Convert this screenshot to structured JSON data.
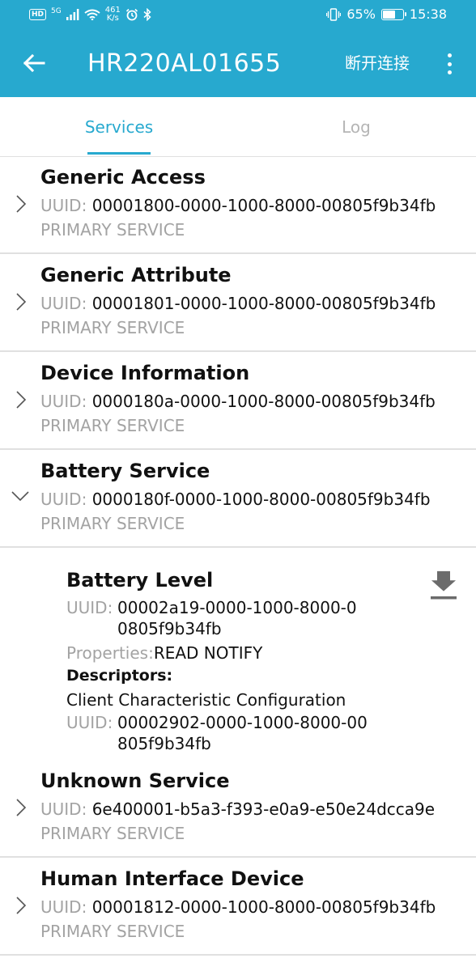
{
  "status_bar": {
    "hd": "HD",
    "network": "5G",
    "speed_value": "461",
    "speed_unit": "K/s",
    "battery_percent": "65%",
    "battery_level": 0.65,
    "time": "15:38"
  },
  "app_bar": {
    "title": "HR220AL01655",
    "disconnect_label": "断开连接",
    "background_color": "#27a9cf"
  },
  "tabs": [
    {
      "label": "Services",
      "active": true
    },
    {
      "label": "Log",
      "active": false
    }
  ],
  "uuid_label": "UUID:",
  "services": [
    {
      "name": "Generic Access",
      "uuid": "00001800-0000-1000-8000-00805f9b34fb",
      "type": "PRIMARY SERVICE",
      "expanded": false
    },
    {
      "name": "Generic Attribute",
      "uuid": "00001801-0000-1000-8000-00805f9b34fb",
      "type": "PRIMARY SERVICE",
      "expanded": false
    },
    {
      "name": "Device Information",
      "uuid": "0000180a-0000-1000-8000-00805f9b34fb",
      "type": "PRIMARY SERVICE",
      "expanded": false
    },
    {
      "name": "Battery Service",
      "uuid": "0000180f-0000-1000-8000-00805f9b34fb",
      "type": "PRIMARY SERVICE",
      "expanded": true
    },
    {
      "name": "Unknown Service",
      "uuid": "6e400001-b5a3-f393-e0a9-e50e24dcca9e",
      "type": "PRIMARY SERVICE",
      "expanded": false
    },
    {
      "name": "Human Interface Device",
      "uuid": "00001812-0000-1000-8000-00805f9b34fb",
      "type": "PRIMARY SERVICE",
      "expanded": false
    }
  ],
  "characteristic": {
    "name": "Battery Level",
    "uuid_line1": "00002a19-0000-1000-8000-0",
    "uuid_line2": "0805f9b34fb",
    "properties_label": "Properties:",
    "properties_value": "READ NOTIFY",
    "descriptors_label": "Descriptors:",
    "descriptor_name": "Client Characteristic Configuration",
    "descriptor_uuid_line1": "00002902-0000-1000-8000-00",
    "descriptor_uuid_line2": "805f9b34fb"
  },
  "icons": {
    "back": "arrow-left-icon",
    "more": "more-vert-icon",
    "collapsed": "chevron-right-icon",
    "expanded": "chevron-down-icon",
    "read": "download-icon"
  }
}
